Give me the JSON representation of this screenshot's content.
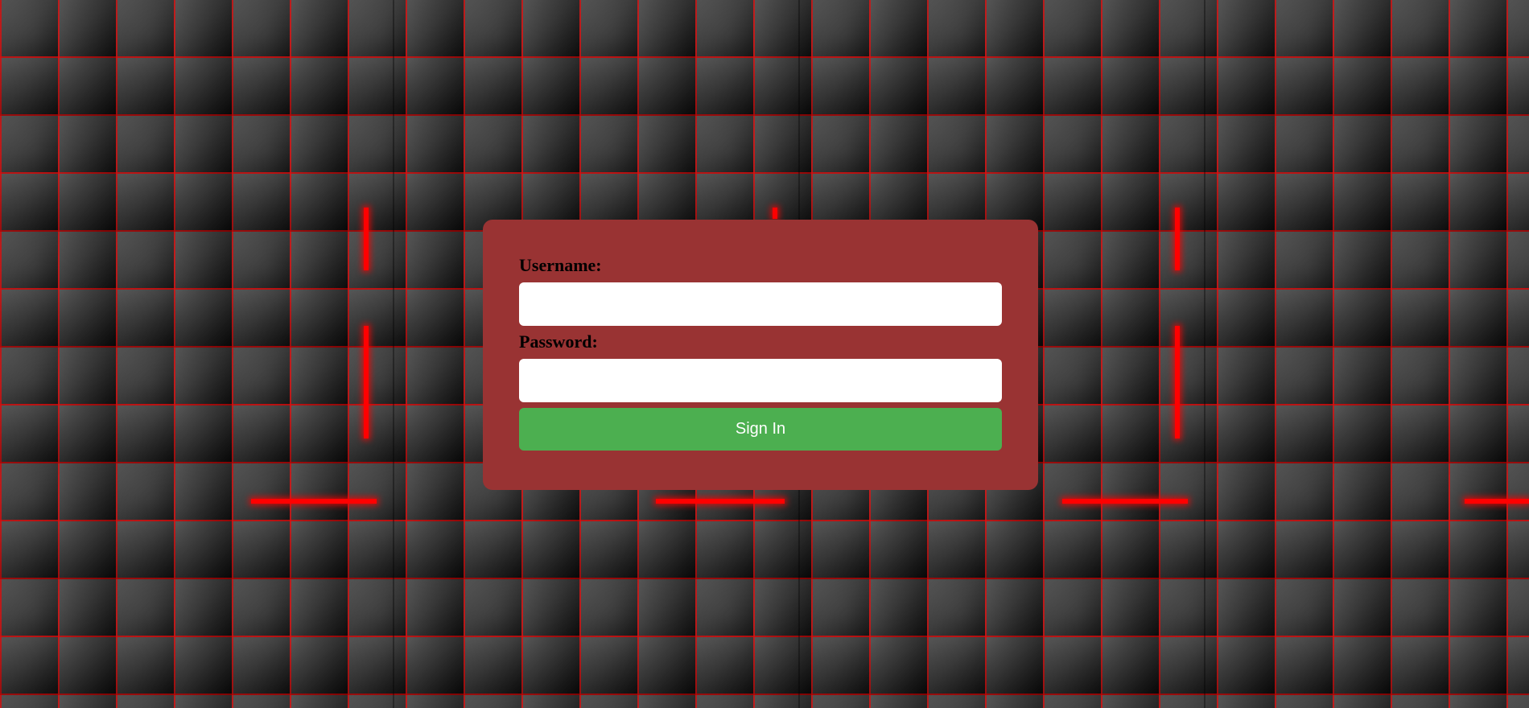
{
  "login_form": {
    "username_label": "Username:",
    "username_value": "",
    "password_label": "Password:",
    "password_value": "",
    "signin_label": "Sign In"
  },
  "colors": {
    "card_background": "#993333",
    "button_background": "#4caf50",
    "button_text": "#ffffff",
    "label_text": "#000000",
    "background_glow": "#ff0000",
    "background_base": "#1a1a1a"
  }
}
